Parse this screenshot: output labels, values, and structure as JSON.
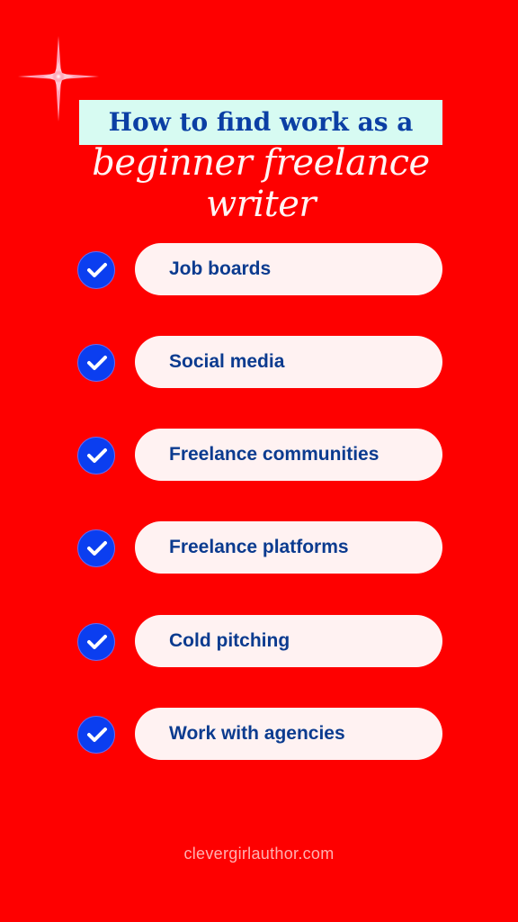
{
  "title": {
    "line1": "How to find work as a",
    "line2": "beginner freelance writer"
  },
  "items": [
    {
      "label": "Job boards",
      "icon": "check-circle-icon"
    },
    {
      "label": "Social media",
      "icon": "check-circle-icon"
    },
    {
      "label": "Freelance communities",
      "icon": "check-circle-icon"
    },
    {
      "label": "Freelance platforms",
      "icon": "check-circle-icon"
    },
    {
      "label": "Cold pitching",
      "icon": "check-circle-icon"
    },
    {
      "label": "Work with agencies",
      "icon": "check-circle-icon"
    }
  ],
  "footer": "clevergirlauthor.com",
  "colors": {
    "background": "#fe0000",
    "title_box": "#d7fbf2",
    "accent_blue": "#0b3ef0",
    "text_blue": "#0b3b8f",
    "pill": "#fff2f2"
  }
}
